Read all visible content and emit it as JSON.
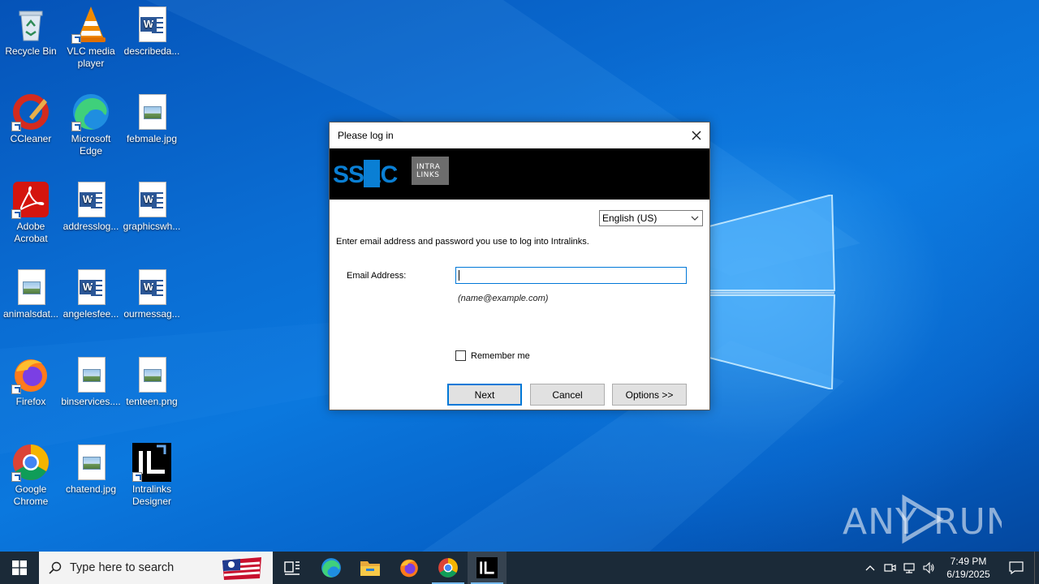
{
  "desktop": {
    "icons": [
      {
        "label": "Recycle Bin",
        "type": "recycle-bin"
      },
      {
        "label": "VLC media player",
        "type": "vlc"
      },
      {
        "label": "describeda...",
        "type": "word"
      },
      {
        "label": "CCleaner",
        "type": "ccleaner"
      },
      {
        "label": "Microsoft Edge",
        "type": "edge"
      },
      {
        "label": "febmale.jpg",
        "type": "image"
      },
      {
        "label": "Adobe Acrobat",
        "type": "acrobat"
      },
      {
        "label": "addresslog...",
        "type": "word"
      },
      {
        "label": "graphicswh...",
        "type": "word"
      },
      {
        "label": "animalsdat...",
        "type": "image"
      },
      {
        "label": "angelesfee...",
        "type": "word"
      },
      {
        "label": "ourmessag...",
        "type": "word"
      },
      {
        "label": "Firefox",
        "type": "firefox"
      },
      {
        "label": "binservices....",
        "type": "image"
      },
      {
        "label": "tenteen.png",
        "type": "image"
      },
      {
        "label": "Google Chrome",
        "type": "chrome"
      },
      {
        "label": "chatend.jpg",
        "type": "image"
      },
      {
        "label": "Intralinks Designer",
        "type": "intralinks"
      }
    ]
  },
  "dialog": {
    "title": "Please log in",
    "close_icon": "close-icon",
    "brand_logo_text": "SS&C",
    "brand_badge_line1": "INTRA",
    "brand_badge_line2": "LINKS",
    "language": "English (US)",
    "instruction": "Enter email address and password you use to log into Intralinks.",
    "email_label": "Email Address:",
    "email_value": "",
    "email_hint": "(name@example.com)",
    "remember_label": "Remember me",
    "remember_checked": false,
    "buttons": {
      "next": "Next",
      "cancel": "Cancel",
      "options": "Options >>"
    }
  },
  "watermark": "ANY RUN",
  "taskbar": {
    "search_placeholder": "Type here to search",
    "apps": [
      "task-view-icon",
      "edge-icon",
      "file-explorer-icon",
      "firefox-icon",
      "chrome-icon",
      "intralinks-icon"
    ],
    "clock_time": "7:49 PM",
    "clock_date": "6/19/2025"
  },
  "colors": {
    "wallpaper": "#0a6dd3",
    "taskbar": "#1b2a38",
    "accent": "#0078d7",
    "ssc_blue": "#0a7fd4"
  }
}
